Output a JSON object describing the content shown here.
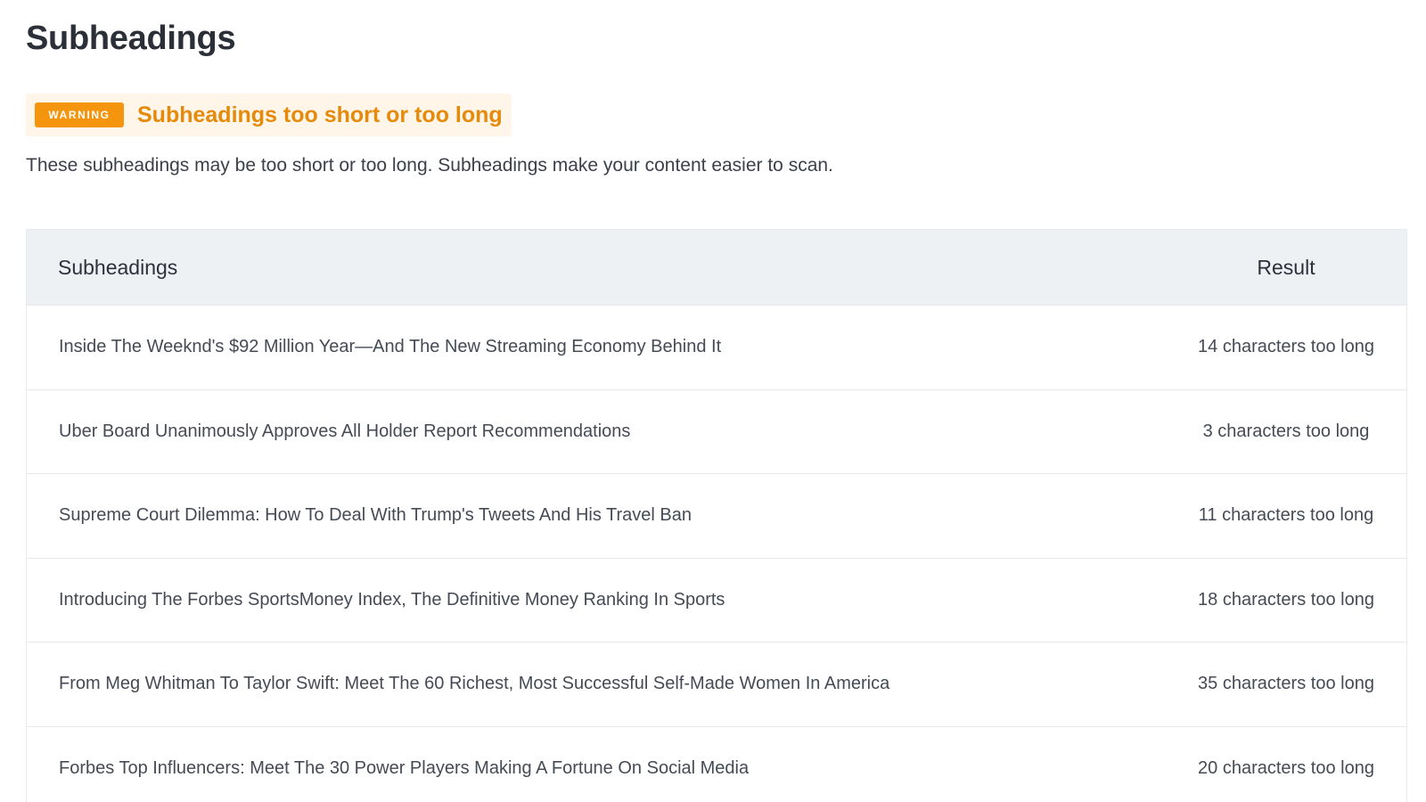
{
  "page": {
    "title": "Subheadings"
  },
  "alert": {
    "badge": "WARNING",
    "title": "Subheadings too short or too long",
    "description": "These subheadings may be too short or too long. Subheadings make your content easier to scan."
  },
  "table": {
    "columns": {
      "subheading": "Subheadings",
      "result": "Result"
    },
    "rows": [
      {
        "subheading": "Inside The Weeknd's $92 Million Year—And The New Streaming Economy Behind It",
        "result": "14 characters too long"
      },
      {
        "subheading": "Uber Board Unanimously Approves All Holder Report Recommendations",
        "result": "3 characters too long"
      },
      {
        "subheading": "Supreme Court Dilemma: How To Deal With Trump's Tweets And His Travel Ban",
        "result": "11 characters too long"
      },
      {
        "subheading": "Introducing The Forbes SportsMoney Index, The Definitive Money Ranking In Sports",
        "result": "18 characters too long"
      },
      {
        "subheading": "From Meg Whitman To Taylor Swift: Meet The 60 Richest, Most Successful Self-Made Women In America",
        "result": "35 characters too long"
      },
      {
        "subheading": "Forbes Top Influencers: Meet The 30 Power Players Making A Fortune On Social Media",
        "result": "20 characters too long"
      }
    ]
  },
  "colors": {
    "warning_badge": "#f5950e",
    "warning_text": "#e58a0a",
    "warning_background": "#fff5e8",
    "table_header_background": "#edf1f4"
  }
}
